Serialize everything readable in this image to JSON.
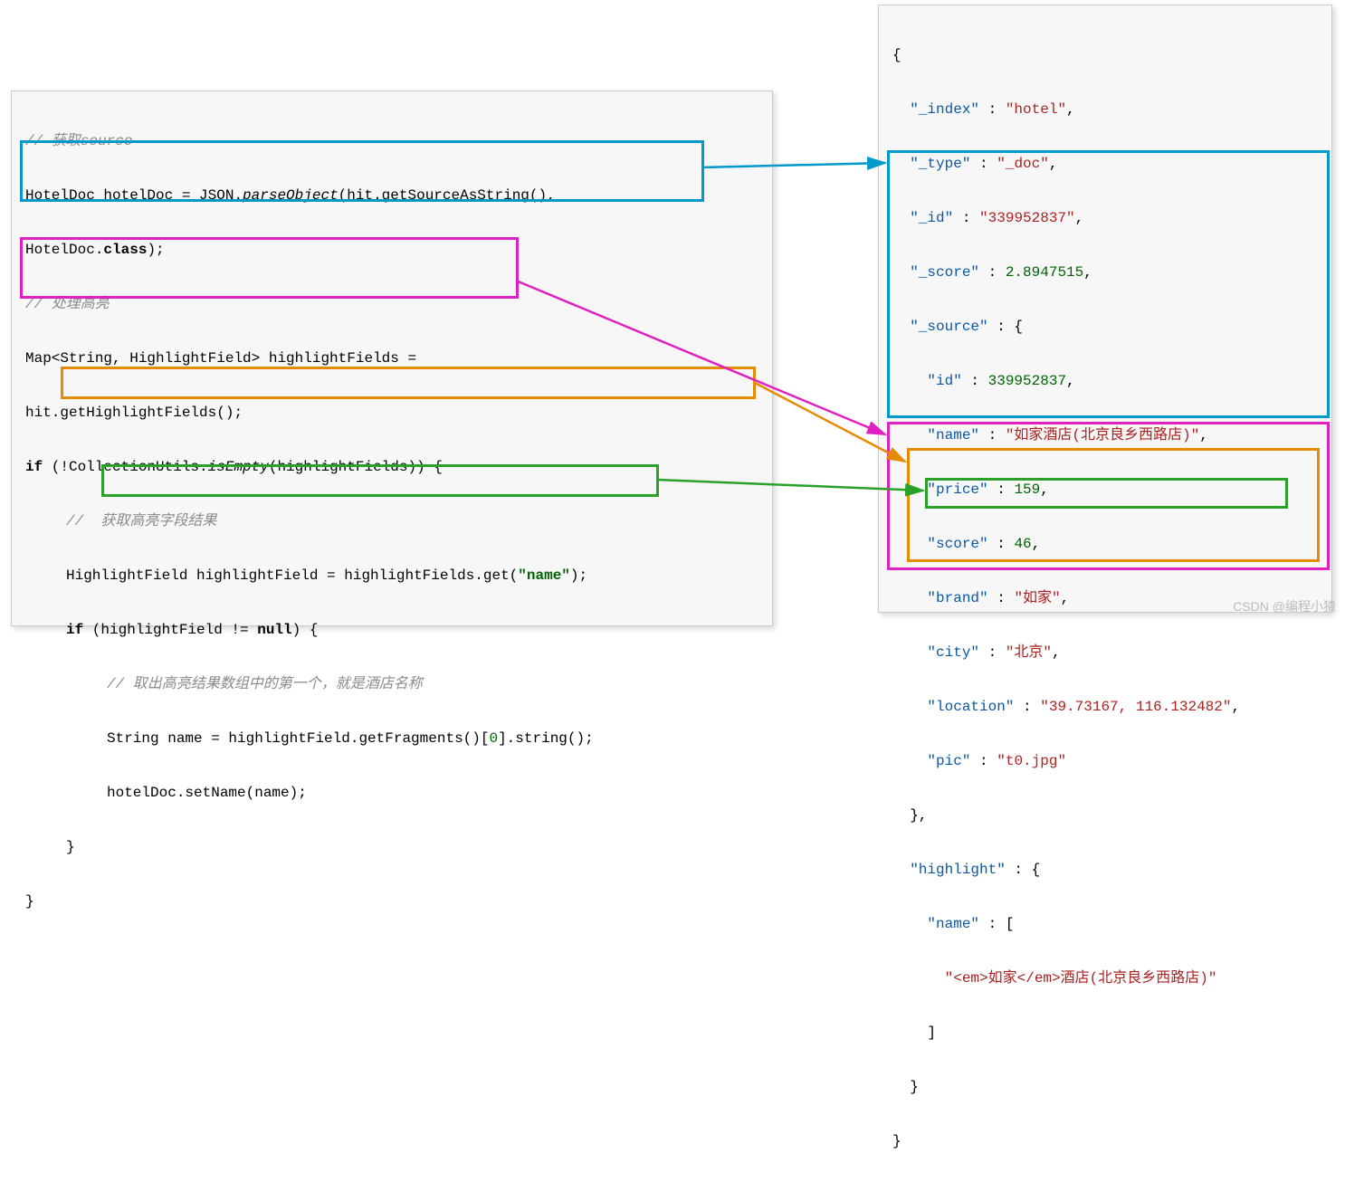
{
  "left": {
    "c1": "// 获取source",
    "l1a": "HotelDoc hotelDoc = JSON.",
    "l1b": "parseObject",
    "l1c": "(hit.getSourceAsString(),",
    "l2a": "HotelDoc.",
    "l2b": "class",
    "l2c": ");",
    "c2": "// 处理高亮",
    "l3": "Map<String, HighlightField> highlightFields =",
    "l4": "hit.getHighlightFields();",
    "l5a": "if",
    "l5b": " (!CollectionUtils.",
    "l5c": "isEmpty",
    "l5d": "(highlightFields)) {",
    "c3": "//  获取高亮字段结果",
    "l6a": "HighlightField highlightField = highlightFields.get(",
    "l6b": "\"name\"",
    "l6c": ");",
    "l7a": "if",
    "l7b": " (highlightField != ",
    "l7c": "null",
    "l7d": ") {",
    "c4": "// 取出高亮结果数组中的第一个，就是酒店名称",
    "l8a": "String name = highlightField.getFragments()[",
    "l8b": "0",
    "l8c": "].string();",
    "l9": "hotelDoc.setName(name);",
    "l10": "}",
    "l11": "}"
  },
  "right": {
    "r0": "{",
    "r1k": "\"_index\"",
    "r1v": "\"hotel\"",
    "r2k": "\"_type\"",
    "r2v": "\"_doc\"",
    "r3k": "\"_id\"",
    "r3v": "\"339952837\"",
    "r4k": "\"_score\"",
    "r4v": "2.8947515",
    "r5k": "\"_source\"",
    "s1k": "\"id\"",
    "s1v": "339952837",
    "s2k": "\"name\"",
    "s2v": "\"如家酒店(北京良乡西路店)\"",
    "s3k": "\"price\"",
    "s3v": "159",
    "s4k": "\"score\"",
    "s4v": "46",
    "s5k": "\"brand\"",
    "s5v": "\"如家\"",
    "s6k": "\"city\"",
    "s6v": "\"北京\"",
    "s7k": "\"location\"",
    "s7v": "\"39.73167, 116.132482\"",
    "s8k": "\"pic\"",
    "s8v": "\"t0.jpg\"",
    "r6": "},",
    "h1k": "\"highlight\"",
    "h2k": "\"name\"",
    "h3v": "\"<em>如家</em>酒店(北京良乡西路店)\"",
    "h4": "]",
    "h5": "}",
    "r7": "}"
  },
  "watermark": "CSDN @编程小猹"
}
